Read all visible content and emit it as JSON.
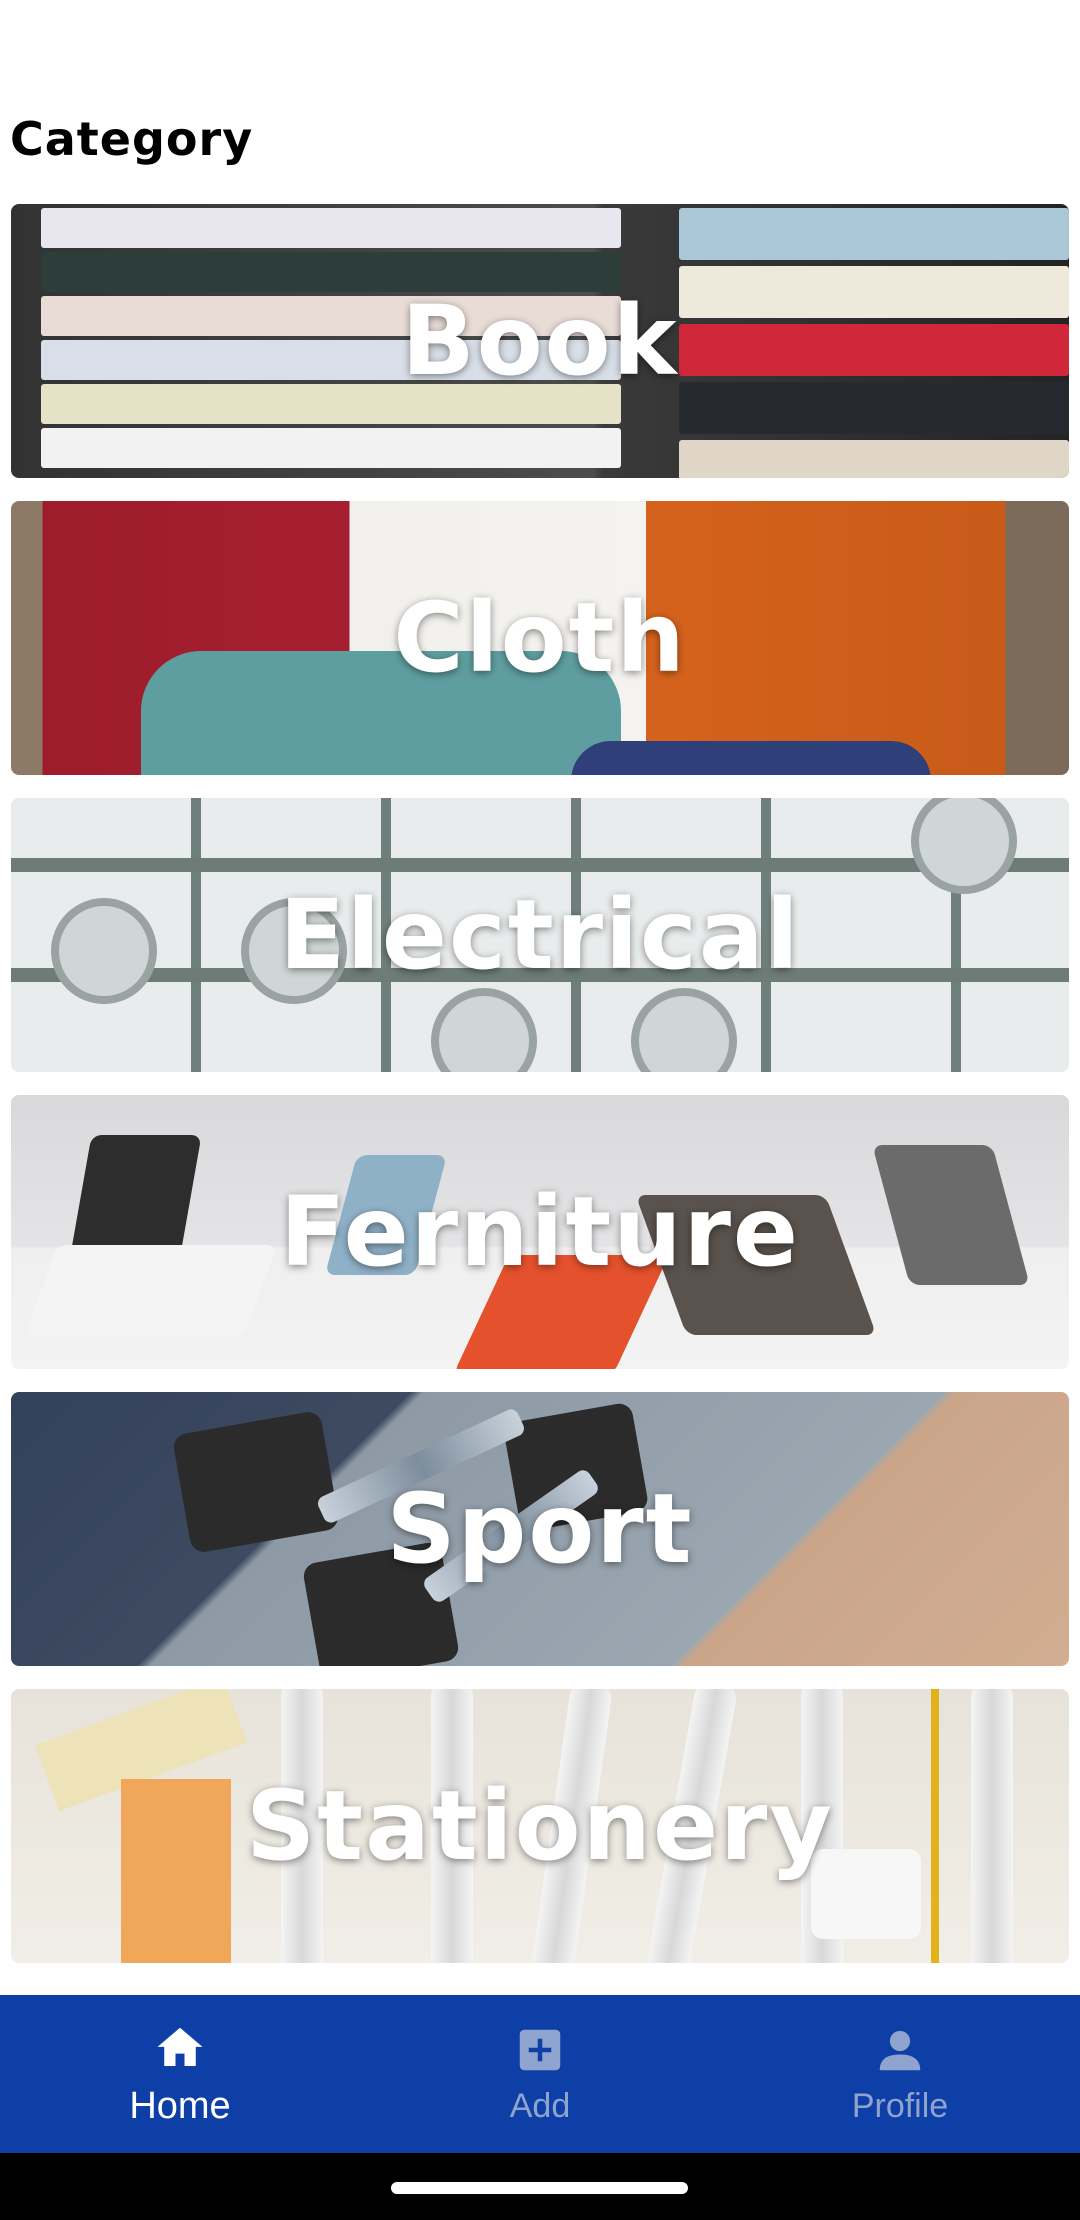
{
  "header": {
    "title": "Category"
  },
  "categories": [
    {
      "label": "Book"
    },
    {
      "label": "Cloth"
    },
    {
      "label": "Electrical"
    },
    {
      "label": "Ferniture"
    },
    {
      "label": "Sport"
    },
    {
      "label": "Stationery"
    }
  ],
  "bottom_nav": {
    "items": [
      {
        "label": "Home",
        "icon": "home-icon",
        "active": true
      },
      {
        "label": "Add",
        "icon": "add-box-icon",
        "active": false
      },
      {
        "label": "Profile",
        "icon": "person-icon",
        "active": false
      }
    ],
    "background": "#0d3fa6",
    "active_color": "#ffffff",
    "inactive_color": "#8fa3cf"
  }
}
